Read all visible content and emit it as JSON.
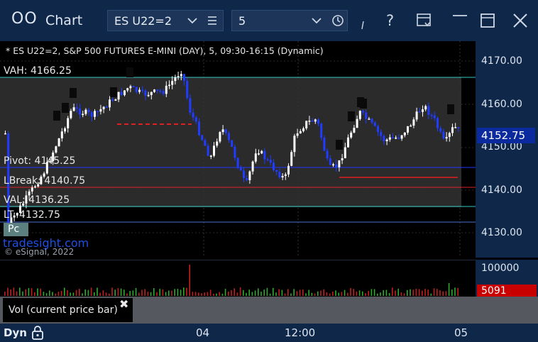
{
  "app": {
    "title": "Chart",
    "icon": "window-icon"
  },
  "toolbar": {
    "symbol": "ES U22=2",
    "interval": "5",
    "icons": [
      "chevron-down-icon",
      "list-icon",
      "chevron-down-icon",
      "clock-icon",
      "pin-icon",
      "help-icon",
      "layout-icon",
      "maximize-icon",
      "close-icon"
    ]
  },
  "chart": {
    "header": "* ES U22=2, S&P 500 FUTURES E-MINI (DAY), 5, 09:30-16:15 (Dynamic)",
    "watermark_brand": "tradesight.com",
    "watermark_copy": "© eSignal, 2022",
    "badge_label": "Pc",
    "levels": [
      {
        "label": "VAH: 4166.25"
      },
      {
        "label": "Pivot: 4145.25"
      },
      {
        "label": "LBreak: 4140.75"
      },
      {
        "label": "VAL: 4136.25"
      },
      {
        "label": "LT: 4132.75"
      }
    ],
    "price_axis": [
      "4170.00",
      "4160.00",
      "4150.00",
      "4140.00",
      "4130.00"
    ],
    "last_price": "4152.75",
    "colors": {
      "up": "#ffffff",
      "down": "#1f3cff",
      "vah_line": "#35c8c8",
      "pivot_line": "#2236ff",
      "break_line": "#e02020",
      "background": "#000000"
    }
  },
  "volume": {
    "axis_label": "100000",
    "last_value": "5091",
    "indicator_label": "Vol (current price bar)",
    "close_glyph": "✖"
  },
  "timebar": {
    "mode": "Dyn",
    "labels": [
      "04",
      "12:00",
      "05"
    ]
  }
}
